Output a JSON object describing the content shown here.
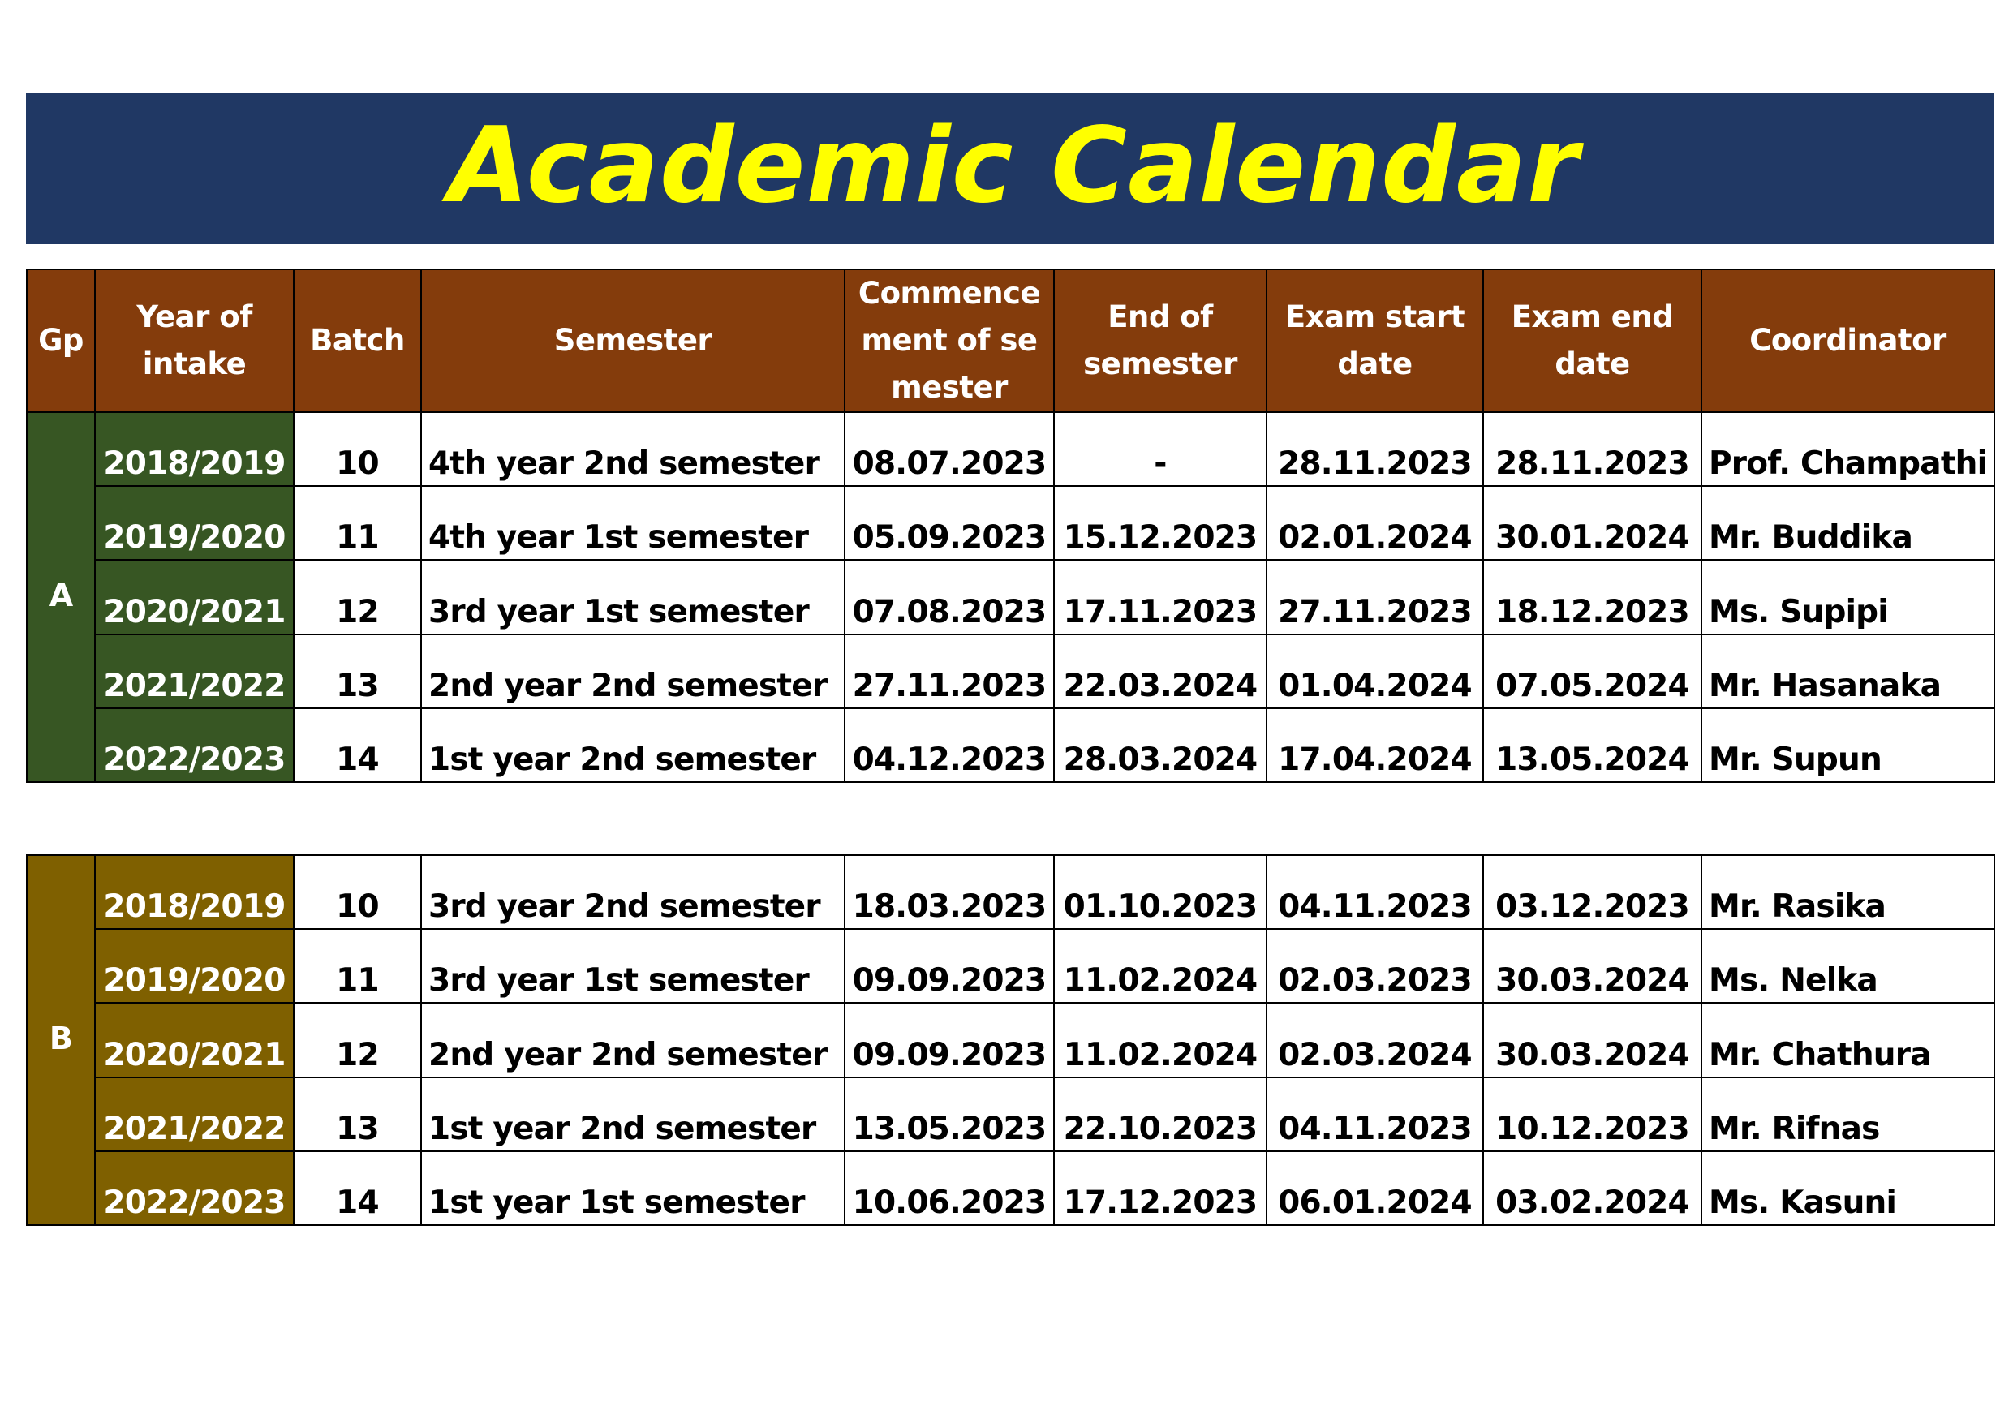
{
  "title": "Academic Calendar",
  "colors": {
    "banner_bg": "#203864",
    "title_text": "#ffff00",
    "header_bg": "#843c0c",
    "group_a_bg": "#375623",
    "group_b_bg": "#7f6000"
  },
  "headers": {
    "gp": "Gp",
    "year_of_intake": "Year of intake",
    "batch": "Batch",
    "semester": "Semester",
    "commencement": "Commencement of semester",
    "end_of_semester": "End of semester",
    "exam_start": "Exam start date",
    "exam_end": "Exam end date",
    "coordinator": "Coordinator"
  },
  "groups": [
    {
      "name": "A",
      "rows": [
        {
          "intake": "2018/2019",
          "batch": "10",
          "semester": "4th year 2nd semester",
          "commencement": "08.07.2023",
          "end": "-",
          "exam_start": "28.11.2023",
          "exam_end": "28.11.2023",
          "coordinator": "Prof. Champathi"
        },
        {
          "intake": "2019/2020",
          "batch": "11",
          "semester": "4th year 1st semester",
          "commencement": "05.09.2023",
          "end": "15.12.2023",
          "exam_start": "02.01.2024",
          "exam_end": "30.01.2024",
          "coordinator": "Mr. Buddika"
        },
        {
          "intake": "2020/2021",
          "batch": "12",
          "semester": "3rd year 1st semester",
          "commencement": "07.08.2023",
          "end": "17.11.2023",
          "exam_start": "27.11.2023",
          "exam_end": "18.12.2023",
          "coordinator": "Ms. Supipi"
        },
        {
          "intake": "2021/2022",
          "batch": "13",
          "semester": "2nd year 2nd semester",
          "commencement": "27.11.2023",
          "end": "22.03.2024",
          "exam_start": "01.04.2024",
          "exam_end": "07.05.2024",
          "coordinator": "Mr. Hasanaka"
        },
        {
          "intake": "2022/2023",
          "batch": "14",
          "semester": "1st year 2nd semester",
          "commencement": "04.12.2023",
          "end": "28.03.2024",
          "exam_start": "17.04.2024",
          "exam_end": "13.05.2024",
          "coordinator": "Mr. Supun"
        }
      ]
    },
    {
      "name": "B",
      "rows": [
        {
          "intake": "2018/2019",
          "batch": "10",
          "semester": "3rd year 2nd semester",
          "commencement": "18.03.2023",
          "end": "01.10.2023",
          "exam_start": "04.11.2023",
          "exam_end": "03.12.2023",
          "coordinator": "Mr. Rasika"
        },
        {
          "intake": "2019/2020",
          "batch": "11",
          "semester": "3rd year 1st semester",
          "commencement": "09.09.2023",
          "end": "11.02.2024",
          "exam_start": "02.03.2023",
          "exam_end": "30.03.2024",
          "coordinator": "Ms. Nelka"
        },
        {
          "intake": "2020/2021",
          "batch": "12",
          "semester": "2nd year 2nd semester",
          "commencement": "09.09.2023",
          "end": "11.02.2024",
          "exam_start": "02.03.2024",
          "exam_end": "30.03.2024",
          "coordinator": "Mr. Chathura"
        },
        {
          "intake": "2021/2022",
          "batch": "13",
          "semester": "1st year 2nd semester",
          "commencement": "13.05.2023",
          "end": "22.10.2023",
          "exam_start": "04.11.2023",
          "exam_end": "10.12.2023",
          "coordinator": "Mr. Rifnas"
        },
        {
          "intake": "2022/2023",
          "batch": "14",
          "semester": "1st year 1st semester",
          "commencement": "10.06.2023",
          "end": "17.12.2023",
          "exam_start": "06.01.2024",
          "exam_end": "03.02.2024",
          "coordinator": "Ms. Kasuni"
        }
      ]
    }
  ]
}
